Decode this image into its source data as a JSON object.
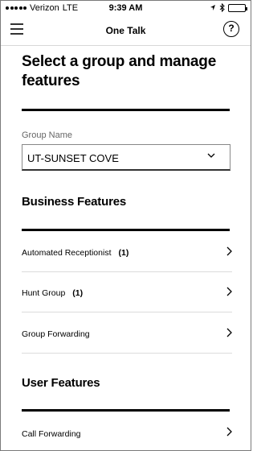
{
  "status_bar": {
    "carrier": "Verizon",
    "network": "LTE",
    "time": "9:39 AM",
    "icons": [
      "signal-dots-icon",
      "location-arrow-icon",
      "bluetooth-icon",
      "battery-icon"
    ]
  },
  "header": {
    "title": "One Talk",
    "menu_icon": "hamburger-menu-icon",
    "help_label": "?"
  },
  "page": {
    "title": "Select a group and manage features"
  },
  "group": {
    "label": "Group Name",
    "selected": "UT-SUNSET COVE"
  },
  "business_features": {
    "title": "Business Features",
    "items": [
      {
        "label": "Automated Receptionist",
        "count": "(1)"
      },
      {
        "label": "Hunt Group",
        "count": "(1)"
      },
      {
        "label": "Group Forwarding",
        "count": ""
      }
    ]
  },
  "user_features": {
    "title": "User Features",
    "items": [
      {
        "label": "Call Forwarding",
        "count": ""
      }
    ]
  }
}
